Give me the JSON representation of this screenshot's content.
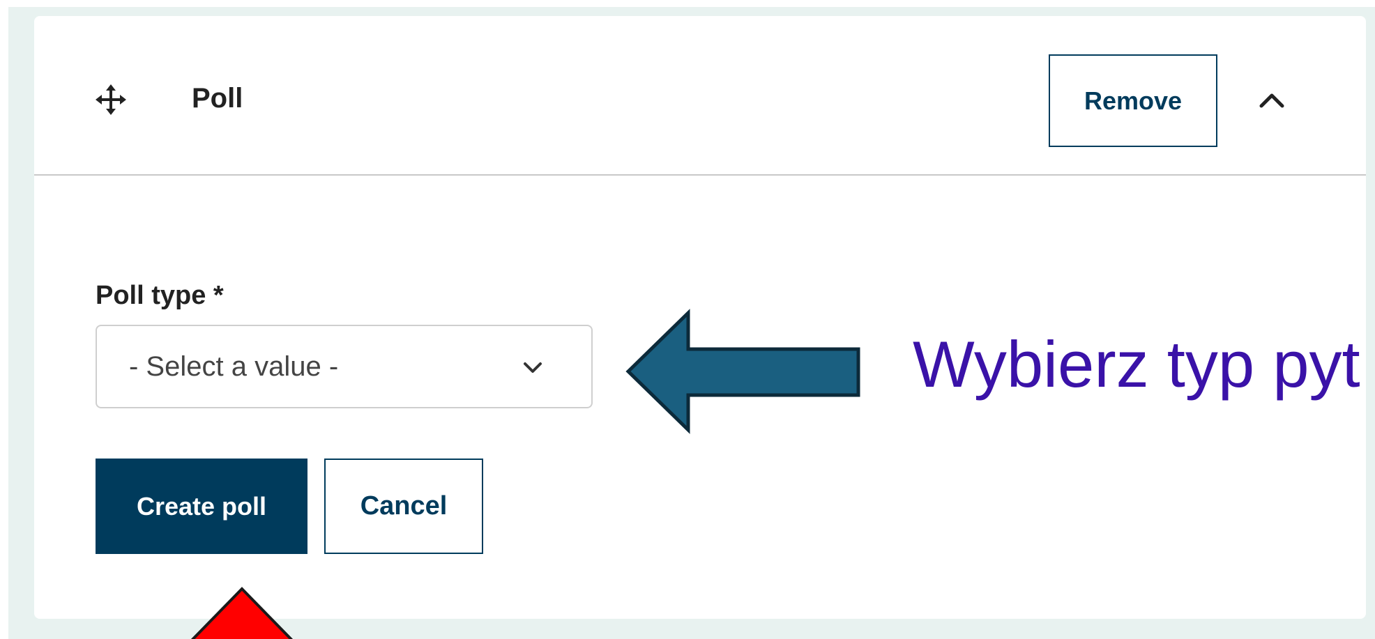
{
  "poll_block": {
    "title": "Poll",
    "remove_label": "Remove",
    "drag_icon": "drag-move-icon",
    "collapse_icon": "chevron-up-icon"
  },
  "form": {
    "poll_type_label": "Poll type *",
    "poll_type_value": "- Select a value -",
    "create_label": "Create poll",
    "cancel_label": "Cancel"
  },
  "annotation": {
    "text": "Wybierz typ pyt",
    "arrow_color": "#1a5f80",
    "text_color": "#3a12a8",
    "pointer_color": "#ff0000"
  },
  "colors": {
    "primary": "#003b5c",
    "background": "#e8f2f0"
  }
}
